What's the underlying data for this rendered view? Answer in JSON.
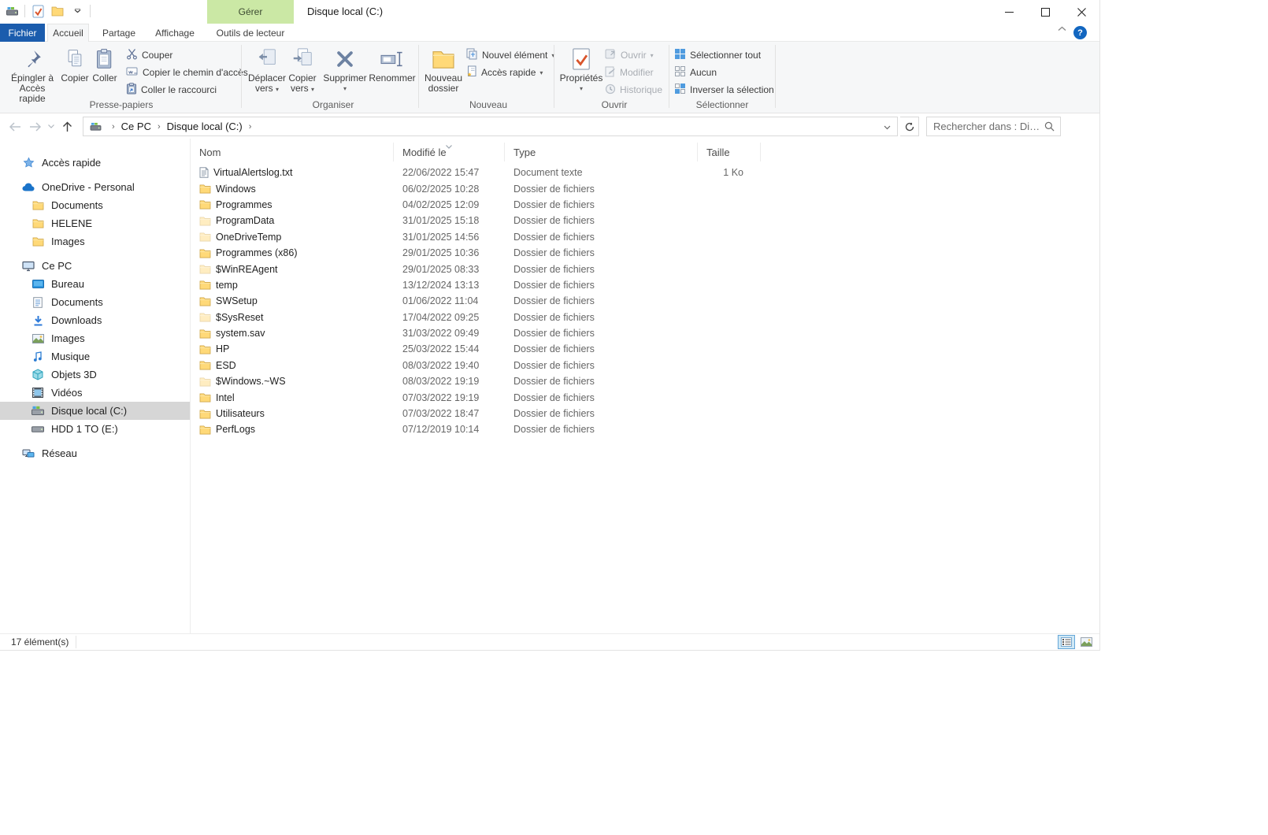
{
  "window": {
    "title": "Disque local (C:)"
  },
  "contextual": {
    "header": "Gérer",
    "tab": "Outils de lecteur"
  },
  "tabs": {
    "file": "Fichier",
    "home": "Accueil",
    "share": "Partage",
    "view": "Affichage"
  },
  "ribbon": {
    "clipboard": {
      "label": "Presse-papiers",
      "pin": "Épingler à\nAccès rapide",
      "copy": "Copier",
      "paste": "Coller",
      "cut": "Couper",
      "copy_path": "Copier le chemin d'accès",
      "paste_shortcut": "Coller le raccourci"
    },
    "organize": {
      "label": "Organiser",
      "move_to": "Déplacer\nvers",
      "copy_to": "Copier\nvers",
      "delete": "Supprimer",
      "rename": "Renommer"
    },
    "new": {
      "label": "Nouveau",
      "new_folder": "Nouveau\ndossier",
      "new_item": "Nouvel élément",
      "quick_access": "Accès rapide"
    },
    "open": {
      "label": "Ouvrir",
      "properties": "Propriétés",
      "open": "Ouvrir",
      "edit": "Modifier",
      "history": "Historique"
    },
    "select": {
      "label": "Sélectionner",
      "select_all": "Sélectionner tout",
      "none": "Aucun",
      "invert": "Inverser la sélection"
    }
  },
  "navbar": {
    "path_root": "Ce PC",
    "path_current": "Disque local (C:)",
    "search_placeholder": "Rechercher dans : Di…"
  },
  "sidebar": {
    "items": [
      {
        "label": "Accès rapide",
        "icon": "star",
        "level": 0,
        "gap": false,
        "selected": false
      },
      {
        "label": "OneDrive - Personal",
        "icon": "cloud",
        "level": 0,
        "gap": true,
        "selected": false
      },
      {
        "label": "Documents",
        "icon": "folder",
        "level": 1,
        "gap": false,
        "selected": false
      },
      {
        "label": "HELENE",
        "icon": "folder",
        "level": 1,
        "gap": false,
        "selected": false
      },
      {
        "label": "Images",
        "icon": "folder",
        "level": 1,
        "gap": false,
        "selected": false
      },
      {
        "label": "Ce PC",
        "icon": "pc",
        "level": 0,
        "gap": true,
        "selected": false
      },
      {
        "label": "Bureau",
        "icon": "desktop",
        "level": 1,
        "gap": false,
        "selected": false
      },
      {
        "label": "Documents",
        "icon": "doc",
        "level": 1,
        "gap": false,
        "selected": false
      },
      {
        "label": "Downloads",
        "icon": "download",
        "level": 1,
        "gap": false,
        "selected": false
      },
      {
        "label": "Images",
        "icon": "picture",
        "level": 1,
        "gap": false,
        "selected": false
      },
      {
        "label": "Musique",
        "icon": "music",
        "level": 1,
        "gap": false,
        "selected": false
      },
      {
        "label": "Objets 3D",
        "icon": "cube",
        "level": 1,
        "gap": false,
        "selected": false
      },
      {
        "label": "Vidéos",
        "icon": "video",
        "level": 1,
        "gap": false,
        "selected": false
      },
      {
        "label": "Disque local (C:)",
        "icon": "drive-c",
        "level": 1,
        "gap": false,
        "selected": true
      },
      {
        "label": "HDD 1 TO (E:)",
        "icon": "hdd",
        "level": 1,
        "gap": false,
        "selected": false
      },
      {
        "label": "Réseau",
        "icon": "network",
        "level": 0,
        "gap": true,
        "selected": false
      }
    ]
  },
  "list": {
    "columns": [
      {
        "key": "name",
        "label": "Nom",
        "sorted": false
      },
      {
        "key": "modified",
        "label": "Modifié le",
        "sorted": true
      },
      {
        "key": "type",
        "label": "Type",
        "sorted": false
      },
      {
        "key": "size",
        "label": "Taille",
        "sorted": false
      }
    ],
    "rows": [
      {
        "name": "VirtualAlertslog.txt",
        "icon": "text-file",
        "modified": "22/06/2022 15:47",
        "type": "Document texte",
        "size": "1 Ko"
      },
      {
        "name": "Windows",
        "icon": "folder",
        "modified": "06/02/2025 10:28",
        "type": "Dossier de fichiers",
        "size": ""
      },
      {
        "name": "Programmes",
        "icon": "folder",
        "modified": "04/02/2025 12:09",
        "type": "Dossier de fichiers",
        "size": ""
      },
      {
        "name": "ProgramData",
        "icon": "folder-pale",
        "modified": "31/01/2025 15:18",
        "type": "Dossier de fichiers",
        "size": ""
      },
      {
        "name": "OneDriveTemp",
        "icon": "folder-pale",
        "modified": "31/01/2025 14:56",
        "type": "Dossier de fichiers",
        "size": ""
      },
      {
        "name": "Programmes (x86)",
        "icon": "folder",
        "modified": "29/01/2025 10:36",
        "type": "Dossier de fichiers",
        "size": ""
      },
      {
        "name": "$WinREAgent",
        "icon": "folder-pale",
        "modified": "29/01/2025 08:33",
        "type": "Dossier de fichiers",
        "size": ""
      },
      {
        "name": "temp",
        "icon": "folder",
        "modified": "13/12/2024 13:13",
        "type": "Dossier de fichiers",
        "size": ""
      },
      {
        "name": "SWSetup",
        "icon": "folder",
        "modified": "01/06/2022 11:04",
        "type": "Dossier de fichiers",
        "size": ""
      },
      {
        "name": "$SysReset",
        "icon": "folder-pale",
        "modified": "17/04/2022 09:25",
        "type": "Dossier de fichiers",
        "size": ""
      },
      {
        "name": "system.sav",
        "icon": "folder",
        "modified": "31/03/2022 09:49",
        "type": "Dossier de fichiers",
        "size": ""
      },
      {
        "name": "HP",
        "icon": "folder",
        "modified": "25/03/2022 15:44",
        "type": "Dossier de fichiers",
        "size": ""
      },
      {
        "name": "ESD",
        "icon": "folder",
        "modified": "08/03/2022 19:40",
        "type": "Dossier de fichiers",
        "size": ""
      },
      {
        "name": "$Windows.~WS",
        "icon": "folder-pale",
        "modified": "08/03/2022 19:19",
        "type": "Dossier de fichiers",
        "size": ""
      },
      {
        "name": "Intel",
        "icon": "folder",
        "modified": "07/03/2022 19:19",
        "type": "Dossier de fichiers",
        "size": ""
      },
      {
        "name": "Utilisateurs",
        "icon": "folder",
        "modified": "07/03/2022 18:47",
        "type": "Dossier de fichiers",
        "size": ""
      },
      {
        "name": "PerfLogs",
        "icon": "folder",
        "modified": "07/12/2019 10:14",
        "type": "Dossier de fichiers",
        "size": ""
      }
    ]
  },
  "statusbar": {
    "count": "17 élément(s)"
  }
}
